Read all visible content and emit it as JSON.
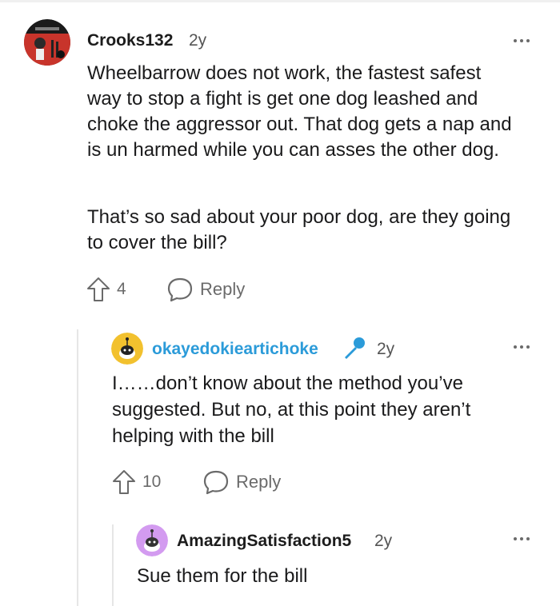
{
  "comments": [
    {
      "author": "Crooks132",
      "time": "2y",
      "paragraphs": [
        "Wheelbarrow does not work, the fastest safest way to stop a fight is get one dog leashed and choke the aggressor out. That dog gets a nap and is un harmed while you can asses the other dog.",
        "That’s so sad about your poor dog, are they going to cover the bill?"
      ],
      "votes": "4",
      "reply_label": "Reply"
    },
    {
      "author": "okayedokieartichoke",
      "time": "2y",
      "paragraphs": [
        "I……don’t know about the method you’ve suggested. But no, at this point they aren’t helping with the bill"
      ],
      "votes": "10",
      "reply_label": "Reply",
      "author_color": "#2b9bd9"
    },
    {
      "author": "AmazingSatisfaction5",
      "time": "2y",
      "paragraphs": [
        "Sue them for the bill"
      ]
    }
  ],
  "icons": {
    "more": "more-options-icon",
    "upvote": "upvote-arrow-icon",
    "reply": "speech-bubble-icon",
    "op_badge": "microphone-icon"
  },
  "colors": {
    "op_author": "#2b9bd9",
    "icon_gray": "#6a6a6a"
  }
}
